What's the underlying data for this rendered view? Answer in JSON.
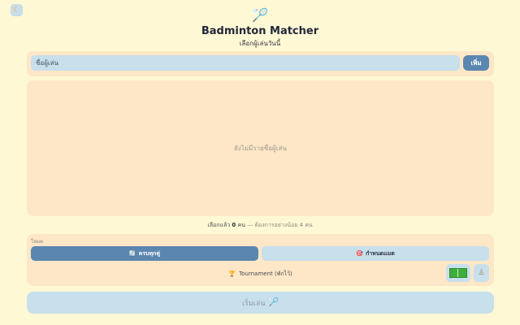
{
  "app": {
    "logo_icon": "badminton-racket-icon",
    "title": "Badminton Matcher",
    "subtitle": "เลือกผู้เล่นวันนี้",
    "theme_toggle_icon": "moon-icon"
  },
  "add_player": {
    "placeholder": "ชื่อผู้เล่น",
    "button_label": "เพิ่ม"
  },
  "players": {
    "empty_message": "ยังไม่มีรายชื่อผู้เล่น"
  },
  "selection": {
    "prefix": "เลือกแล้ว",
    "count": "0",
    "unit": "คน",
    "separator": "—",
    "hint": "ต้องการอย่างน้อย 4 คน"
  },
  "mode": {
    "label": "โหมด",
    "options": [
      {
        "icon": "shuffle-icon",
        "glyph": "🔄",
        "label": "ครบทุกคู่",
        "active": true
      },
      {
        "icon": "target-icon",
        "glyph": "🎯",
        "label": "กำหนดแมต",
        "active": false
      }
    ],
    "tournament": {
      "icon": "trophy-icon",
      "glyph": "🏆",
      "label": "Tournament (พักไว้)"
    }
  },
  "tools": {
    "court_icon": "court-icon",
    "figure_icon": "figure-icon"
  },
  "start": {
    "label": "เริ่มเล่น",
    "icon": "badminton-racket-icon"
  },
  "colors": {
    "background": "#FFF8D5",
    "card": "#FDE7C7",
    "accent": "#5A86B0",
    "light_accent": "#C8DFEC"
  }
}
